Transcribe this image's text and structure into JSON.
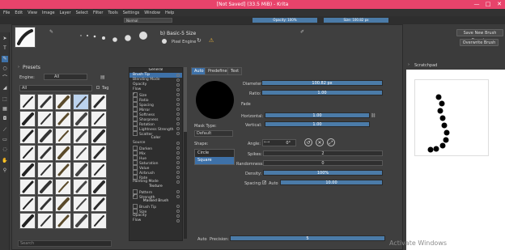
{
  "window": {
    "title": "[Not Saved]  (33.5 MiB)  - Krita",
    "min": "—",
    "max": "□",
    "close": "✕"
  },
  "menu": [
    "File",
    "Edit",
    "View",
    "Image",
    "Layer",
    "Select",
    "Filter",
    "Tools",
    "Settings",
    "Window",
    "Help"
  ],
  "toolbar": {
    "blend_mode": "Normal",
    "opacity": "Opacity: 100%",
    "size": "Size: 100.82 px"
  },
  "preset_header": {
    "title": "b) Basic-5 Size",
    "engine": "Pixel Engine"
  },
  "header_buttons": {
    "save_new": "Save New Brush Preset...",
    "overwrite": "Overwrite Brush"
  },
  "presets": {
    "title": "Presets",
    "engine_label": "Engine:",
    "engine_value": "All",
    "filter_value": "All",
    "tag_label": "Tag",
    "search_placeholder": "Search",
    "count": 40
  },
  "options": [
    {
      "label": "General",
      "type": "section"
    },
    {
      "label": "Brush Tip",
      "type": "item",
      "selected": true
    },
    {
      "label": "Blending Mode",
      "type": "item"
    },
    {
      "label": "Opacity",
      "type": "item"
    },
    {
      "label": "Flow",
      "type": "item"
    },
    {
      "label": "Size",
      "type": "check",
      "checked": true
    },
    {
      "label": "Ratio",
      "type": "check"
    },
    {
      "label": "Spacing",
      "type": "check"
    },
    {
      "label": "Mirror",
      "type": "check"
    },
    {
      "label": "Softness",
      "type": "check"
    },
    {
      "label": "Sharpness",
      "type": "check"
    },
    {
      "label": "Rotation",
      "type": "check"
    },
    {
      "label": "Lightness Strength",
      "type": "check"
    },
    {
      "label": "Scatter",
      "type": "check"
    },
    {
      "label": "Color",
      "type": "section"
    },
    {
      "label": "Source",
      "type": "item"
    },
    {
      "label": "Darken",
      "type": "check"
    },
    {
      "label": "Mix",
      "type": "check"
    },
    {
      "label": "Hue",
      "type": "check"
    },
    {
      "label": "Saturation",
      "type": "check"
    },
    {
      "label": "Value",
      "type": "check"
    },
    {
      "label": "Airbrush",
      "type": "check"
    },
    {
      "label": "Rate",
      "type": "check"
    },
    {
      "label": "Painting Mode",
      "type": "item"
    },
    {
      "label": "Texture",
      "type": "section"
    },
    {
      "label": "Pattern",
      "type": "check"
    },
    {
      "label": "Strength",
      "type": "check",
      "checked": true
    },
    {
      "label": "Masked Brush",
      "type": "section"
    },
    {
      "label": "Brush Tip",
      "type": "check"
    },
    {
      "label": "Size",
      "type": "check"
    },
    {
      "label": "Opacity",
      "type": "item"
    },
    {
      "label": "Flow",
      "type": "item"
    }
  ],
  "tabs": [
    "Auto",
    "Predefined",
    "Text"
  ],
  "brush": {
    "diameter_label": "Diameter:",
    "diameter_value": "100.82 px",
    "ratio_label": "Ratio:",
    "ratio_value": "1.00",
    "fade_label": "Fade",
    "horizontal_label": "Horizontal:",
    "horizontal_value": "1.00",
    "vertical_label": "Vertical:",
    "vertical_value": "1.00",
    "mask_type_label": "Mask Type:",
    "mask_type_value": "Default",
    "shape_label": "Shape:",
    "shape_options": [
      "Circle",
      "Square"
    ],
    "angle_label": "Angle:",
    "angle_value": "0°",
    "spikes_label": "Spikes:",
    "spikes_value": "2",
    "randomness_label": "Randomness:",
    "randomness_value": "0",
    "density_label": "Density:",
    "density_value": "100%",
    "spacing_label": "Spacing:",
    "spacing_auto": "Auto",
    "spacing_value": "10.00",
    "bottom_auto": "Auto",
    "precision_label": "Precision:",
    "precision_value": "5"
  },
  "scratchpad": {
    "title": "Scratchpad"
  },
  "watermark": "Activate Windows",
  "colors": {
    "accent": "#e8436b",
    "selection": "#3e71a8"
  }
}
